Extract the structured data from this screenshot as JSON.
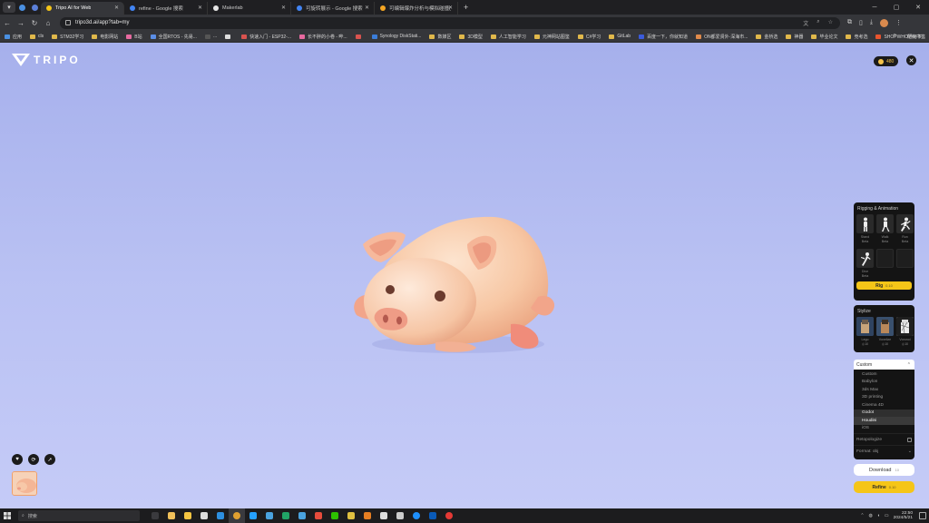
{
  "browser": {
    "tabs": [
      {
        "label": "Tripo AI for Web",
        "color": "#f5c518",
        "active": true
      },
      {
        "label": "refine - Google 搜索",
        "color": "#4285f4",
        "active": false
      },
      {
        "label": "Makerlab",
        "color": "#e6e6e6",
        "active": false
      },
      {
        "label": "可旋转展示 - Google 搜索",
        "color": "#4285f4",
        "active": false
      },
      {
        "label": "可编辑爆炸分析与模拟碰撞(修...",
        "color": "#f5a623",
        "active": false
      }
    ],
    "url": "tripo3d.ai/app?tab=my",
    "bookmarks": [
      {
        "label": "应用",
        "color": "#4a90e2"
      },
      {
        "label": "cls",
        "color": "#e0b84b"
      },
      {
        "label": "STM32学习",
        "color": "#e0b84b"
      },
      {
        "label": "电影网站",
        "color": "#e0b84b"
      },
      {
        "label": "B站",
        "color": "#e86aa0"
      },
      {
        "label": "全国RTOS - 先易...",
        "color": "#5b8ee6"
      },
      {
        "label": "...",
        "color": "#555"
      },
      {
        "label": "",
        "color": "#ddd"
      },
      {
        "label": "快速入门 - ESP32-...",
        "color": "#d9534f"
      },
      {
        "label": "长不胖的小卷 - 哔...",
        "color": "#e86aa0"
      },
      {
        "label": "",
        "color": "#d9534f"
      },
      {
        "label": "Synology DiskStati...",
        "color": "#3b7dd8"
      },
      {
        "label": "数媒区",
        "color": "#e0b84b"
      },
      {
        "label": "3D模型",
        "color": "#e0b84b"
      },
      {
        "label": "人工智能学习",
        "color": "#e0b84b"
      },
      {
        "label": "元神网站图鉴",
        "color": "#e0b84b"
      },
      {
        "label": "C#学习",
        "color": "#e0b84b"
      },
      {
        "label": "GitLab",
        "color": "#e0b84b"
      },
      {
        "label": "百度一下，你就知道",
        "color": "#3b5bdb"
      },
      {
        "label": "ON都爱贤外·深海市...",
        "color": "#e08a4b"
      },
      {
        "label": "金桥选",
        "color": "#e0b84b"
      },
      {
        "label": "神器",
        "color": "#e0b84b"
      },
      {
        "label": "毕业论文",
        "color": "#e0b84b"
      },
      {
        "label": "竞考选",
        "color": "#e0b84b"
      },
      {
        "label": "SHOPWHO通用平...",
        "color": "#e8542e"
      }
    ],
    "bookmarks_all": "所有书签"
  },
  "app": {
    "logo": "TRIPO",
    "credits": "480",
    "rig": {
      "title": "Rigging & Animation",
      "options": [
        {
          "label": "Stand",
          "sub": "Beta"
        },
        {
          "label": "Walk",
          "sub": "Beta"
        },
        {
          "label": "Run",
          "sub": "Beta"
        },
        {
          "label": "Dive",
          "sub": "Beta"
        }
      ],
      "button": "Rig",
      "cost": "0.10"
    },
    "stylize": {
      "title": "Stylize",
      "options": [
        {
          "label": "Lego",
          "cost": "10"
        },
        {
          "label": "Voxelize",
          "cost": "10"
        },
        {
          "label": "Voronoi",
          "cost": "10"
        }
      ]
    },
    "export": {
      "selected": "Custom",
      "options": [
        "Custom",
        "Babylon",
        "3ds Max",
        "3D printing",
        "Cinema 4D",
        "Godot",
        "Houdini",
        "iOS"
      ],
      "hover": "Godot",
      "highlight": "Houdini",
      "retopology_label": "Retopologize",
      "format_label": "Format: obj"
    },
    "download": {
      "label": "Download",
      "cost": "10"
    },
    "refine": {
      "label": "Refine",
      "cost": "0.10"
    }
  },
  "taskbar": {
    "search_placeholder": "搜索",
    "time": "22:50",
    "date": "2024/5/21",
    "apps": [
      {
        "name": "file-explorer",
        "color": "#3a3a3e"
      },
      {
        "name": "store",
        "color": "#f0c05a"
      },
      {
        "name": "folder",
        "color": "#f5c542"
      },
      {
        "name": "mail",
        "color": "#ddd"
      },
      {
        "name": "vscode",
        "color": "#2d8fe0"
      },
      {
        "name": "chrome",
        "color": "#e0a030"
      },
      {
        "name": "tiktok",
        "color": "#25a0ff"
      },
      {
        "name": "notes",
        "color": "#4aa3df"
      },
      {
        "name": "excel",
        "color": "#21a366"
      },
      {
        "name": "git",
        "color": "#4aa3df"
      },
      {
        "name": "games",
        "color": "#e74c3c"
      },
      {
        "name": "wechat",
        "color": "#2dc100"
      },
      {
        "name": "edit",
        "color": "#e0c040"
      },
      {
        "name": "search",
        "color": "#e67e22"
      },
      {
        "name": "capture",
        "color": "#ddd"
      },
      {
        "name": "camera",
        "color": "#ccc"
      },
      {
        "name": "edge",
        "color": "#1e90ff"
      },
      {
        "name": "terminal",
        "color": "#0a5ab8"
      },
      {
        "name": "recorder",
        "color": "#e53935"
      }
    ]
  }
}
